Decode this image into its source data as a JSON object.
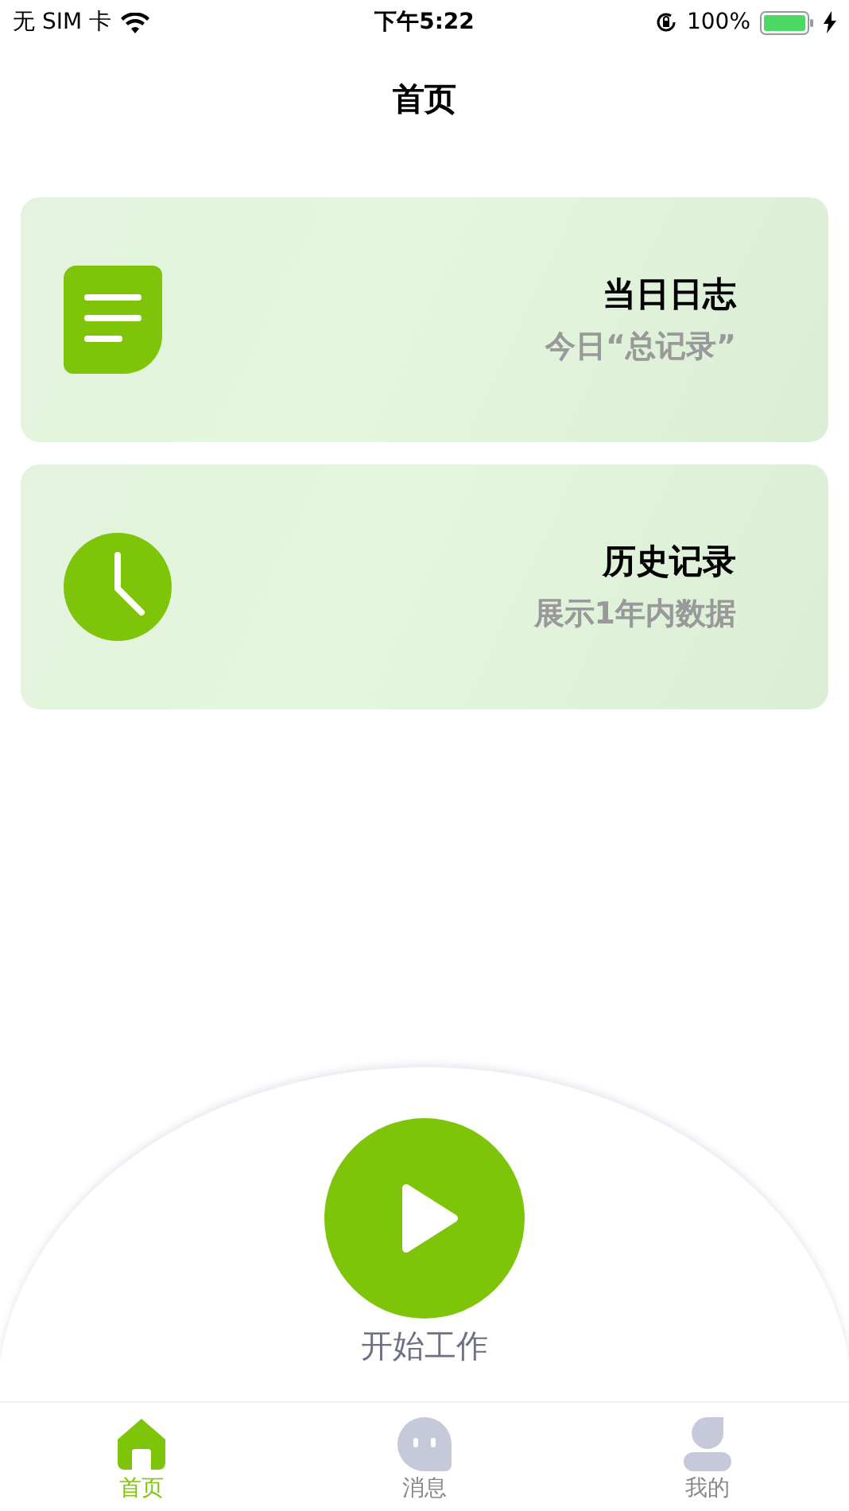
{
  "status_bar": {
    "carrier": "无 SIM 卡",
    "time": "下午5:22",
    "battery": "100%"
  },
  "nav": {
    "title": "首页"
  },
  "cards": [
    {
      "kind": "log",
      "title": "当日日志",
      "subtitle": "今日“总记录”"
    },
    {
      "kind": "history",
      "title": "历史记录",
      "subtitle": "展示1年内数据"
    }
  ],
  "start": {
    "label": "开始工作"
  },
  "tabs": [
    {
      "kind": "home",
      "label": "首页",
      "selected": true
    },
    {
      "kind": "message",
      "label": "消息",
      "selected": false
    },
    {
      "kind": "profile",
      "label": "我的",
      "selected": false
    }
  ]
}
